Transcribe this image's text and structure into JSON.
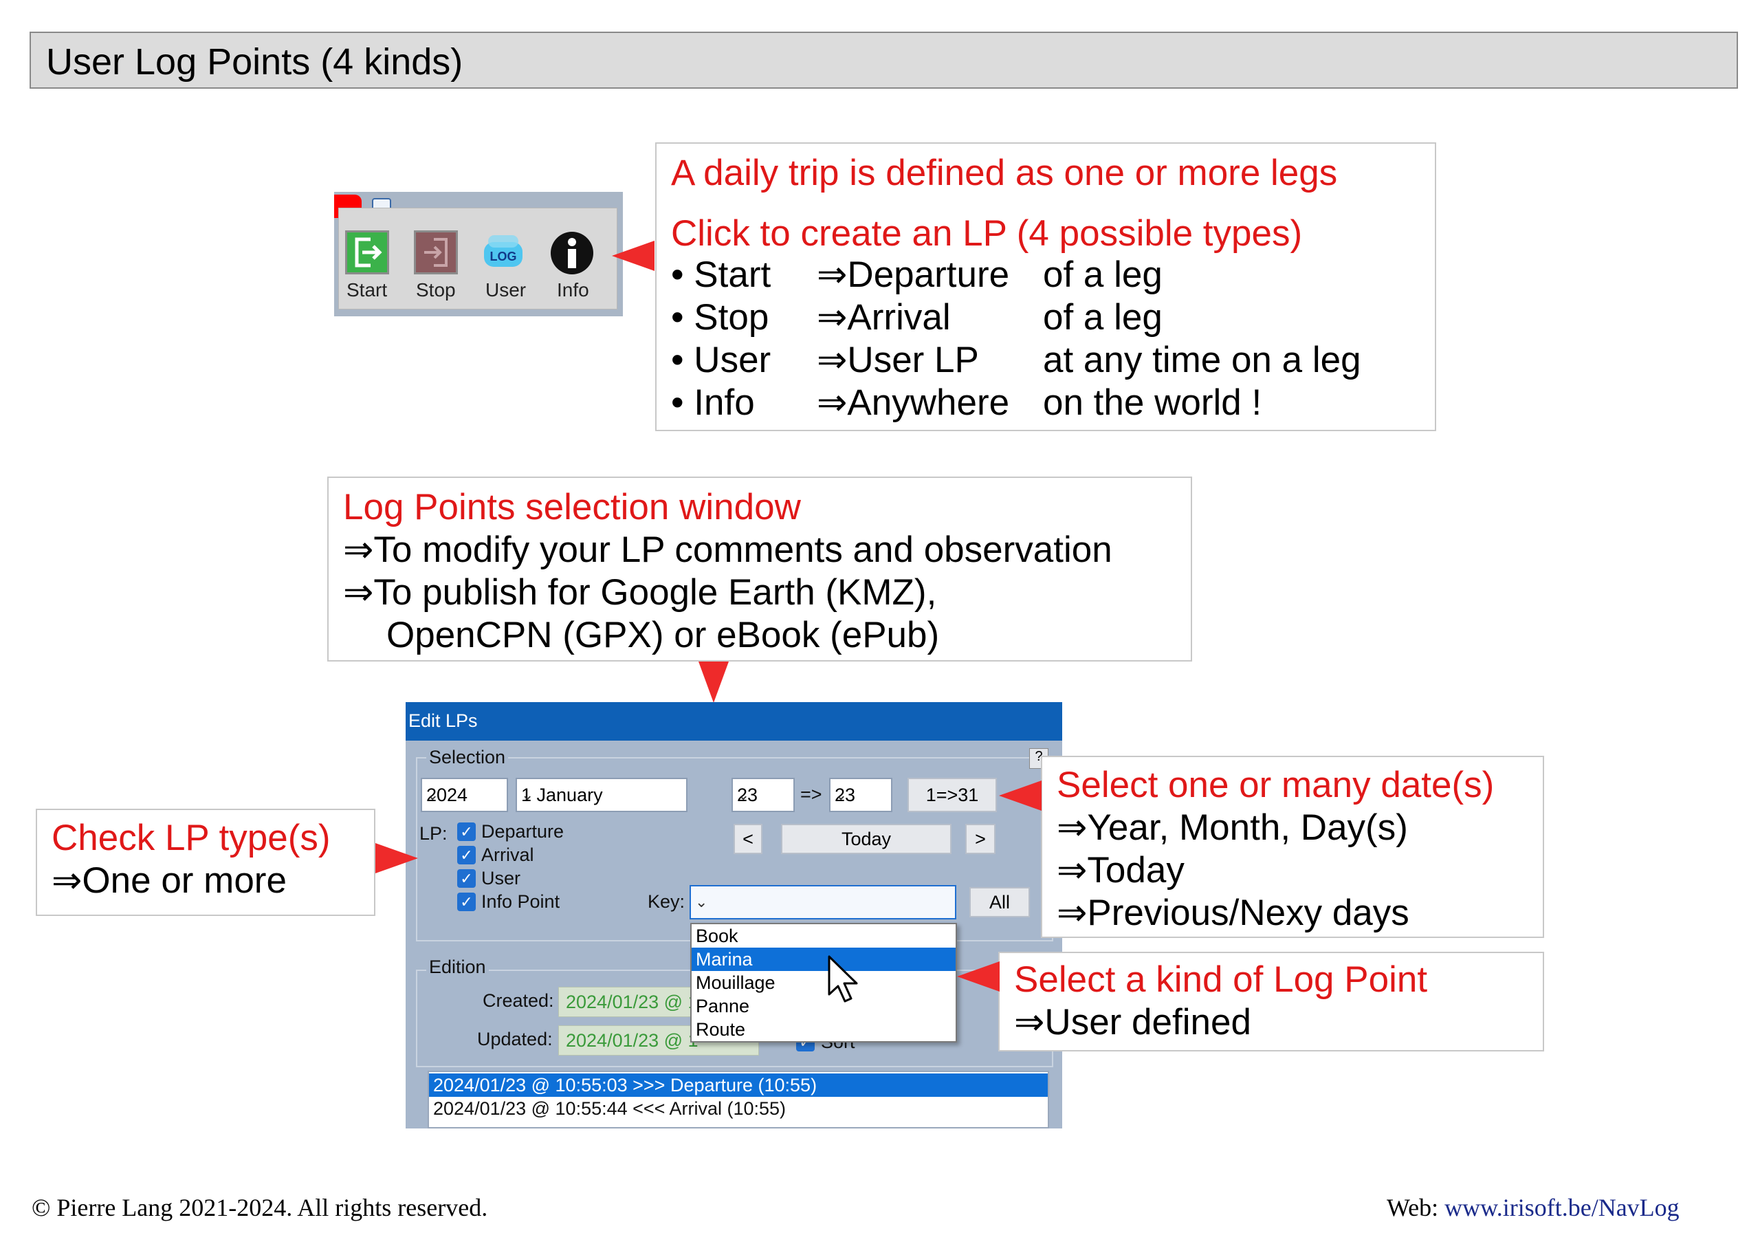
{
  "title": "User Log Points (4 kinds)",
  "toolbar": {
    "buttons": [
      {
        "label": "Start",
        "icon": "exit-arrow-icon"
      },
      {
        "label": "Stop",
        "icon": "enter-arrow-icon"
      },
      {
        "label": "User",
        "icon": "log-icon",
        "icon_text": "LOG"
      },
      {
        "label": "Info",
        "icon": "info-icon"
      }
    ]
  },
  "callout_top": {
    "line1": "A daily trip is defined as one or more legs",
    "line2": "Click to create an LP (4 possible types)",
    "items": [
      {
        "bullet": "•",
        "name": "Start",
        "arrow": "⇒",
        "target": "Departure",
        "desc": "of a leg"
      },
      {
        "bullet": "•",
        "name": "Stop",
        "arrow": "⇒",
        "target": "Arrival",
        "desc": "of a leg"
      },
      {
        "bullet": "•",
        "name": "User",
        "arrow": "⇒",
        "target": "User LP",
        "desc": "at any time on a leg"
      },
      {
        "bullet": "•",
        "name": "Info",
        "arrow": "⇒",
        "target": "Anywhere",
        "desc": "on the world !"
      }
    ]
  },
  "callout_selection": {
    "heading": "Log Points selection window",
    "lines": [
      "To modify your LP comments and observation",
      "To publish for Google Earth (KMZ),",
      "OpenCPN (GPX) or eBook (ePub)"
    ],
    "arrow": "⇒"
  },
  "callout_check": {
    "heading": "Check LP type(s)",
    "line": "One or more",
    "arrow": "⇒"
  },
  "callout_dates": {
    "heading": "Select one or many date(s)",
    "lines": [
      "Year, Month, Day(s)",
      "Today",
      "Previous/Nexy days"
    ],
    "arrow": "⇒"
  },
  "callout_kind": {
    "heading": "Select a kind of Log Point",
    "line": "User defined",
    "arrow": "⇒"
  },
  "edit_window": {
    "title": "Edit LPs",
    "selection_label": "Selection",
    "year": "2024",
    "month": "1 January",
    "day_from": "23",
    "range_sep": "=>",
    "day_to": "23",
    "range_button": "1=>31",
    "prev_button": "<",
    "today_button": "Today",
    "next_button": ">",
    "lp_label": "LP:",
    "types": [
      "Departure",
      "Arrival",
      "User",
      "Info Point"
    ],
    "key_label": "Key:",
    "key_value": "",
    "all_button": "All",
    "dropdown_options": [
      "Book",
      "Marina",
      "Mouillage",
      "Panne",
      "Route"
    ],
    "dropdown_selected": "Marina",
    "edition_label": "Edition",
    "created_label": "Created:",
    "created_value": "2024/01/23 @ 1",
    "updated_label": "Updated:",
    "updated_value": "2024/01/23 @ 1",
    "sort_label": "Sort",
    "list": [
      "2024/01/23 @ 10:55:03  >>>  Departure (10:55)",
      "2024/01/23 @ 10:55:44  <<<  Arrival (10:55)"
    ],
    "help_icon": "?"
  },
  "footer": {
    "copyright": "© Pierre Lang 2021-2024. All rights reserved.",
    "web_label": "Web: ",
    "web_link": "www.irisoft.be/NavLog"
  },
  "colors": {
    "accent_red": "#e01818",
    "window_blue": "#0e60b6",
    "link_blue": "#1a2a8a"
  }
}
